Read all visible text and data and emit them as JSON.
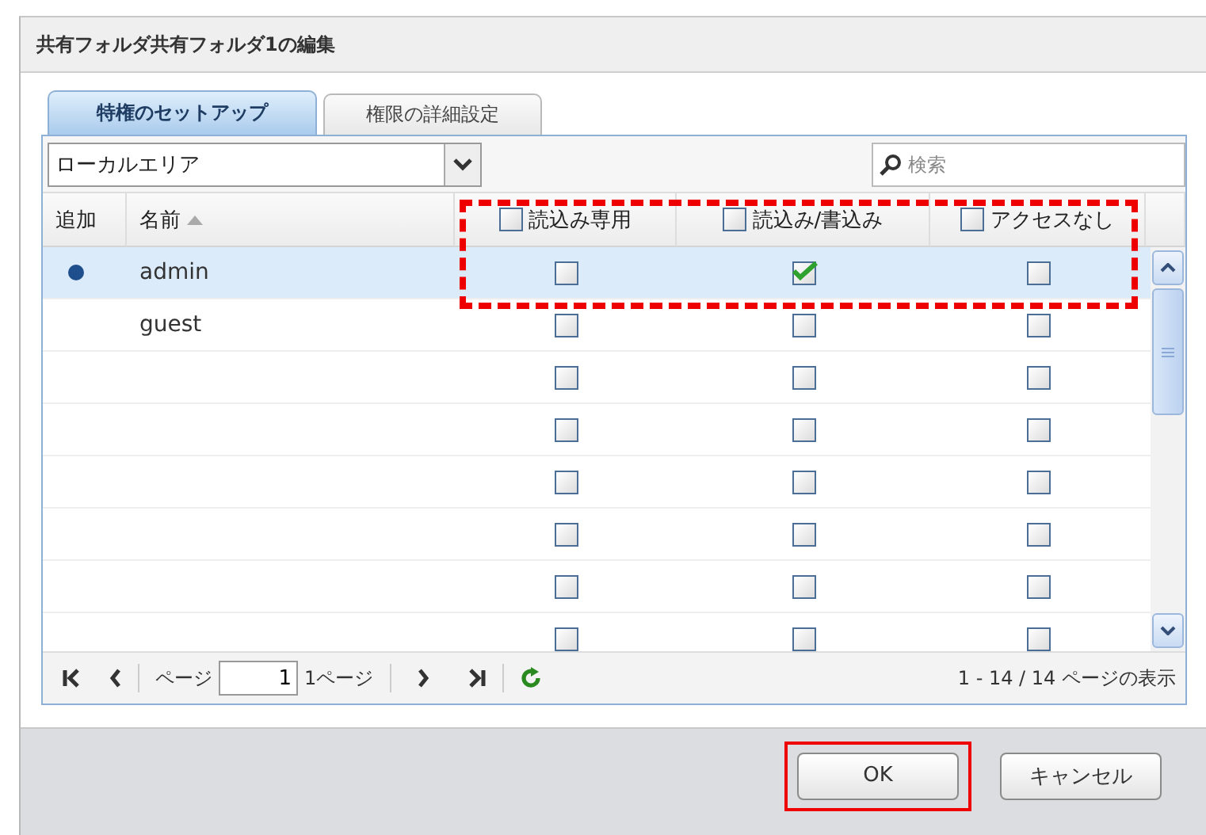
{
  "dialog": {
    "title": "共有フォルダ共有フォルダ1の編集"
  },
  "tabs": [
    {
      "label": "特権のセットアップ",
      "selected": true
    },
    {
      "label": "権限の詳細設定",
      "selected": false
    }
  ],
  "filter": {
    "value": "ローカルエリア"
  },
  "search": {
    "placeholder": "検索"
  },
  "columns": [
    {
      "label": "追加",
      "kind": "plain"
    },
    {
      "label": "名前",
      "kind": "sort"
    },
    {
      "label": "読込み専用",
      "kind": "check",
      "checked": false
    },
    {
      "label": "読込み/書込み",
      "kind": "check",
      "checked": false
    },
    {
      "label": "アクセスなし",
      "kind": "check",
      "checked": false
    }
  ],
  "rows": [
    {
      "name": "admin",
      "added": true,
      "selected": true,
      "perms": [
        false,
        true,
        false
      ]
    },
    {
      "name": "guest",
      "added": false,
      "selected": false,
      "perms": [
        false,
        false,
        false
      ]
    },
    {
      "added": false,
      "selected": false,
      "perms": [
        false,
        false,
        false
      ]
    },
    {
      "added": false,
      "selected": false,
      "perms": [
        false,
        false,
        false
      ]
    },
    {
      "added": false,
      "selected": false,
      "perms": [
        false,
        false,
        false
      ]
    },
    {
      "added": false,
      "selected": false,
      "perms": [
        false,
        false,
        false
      ]
    },
    {
      "added": false,
      "selected": false,
      "perms": [
        false,
        false,
        false
      ]
    },
    {
      "added": false,
      "selected": false,
      "perms": [
        false,
        false,
        false
      ]
    }
  ],
  "permission_highlight": true,
  "pager": {
    "page_label": "ページ",
    "page": "1",
    "total": "1ページ",
    "summary": "1 - 14 / 14 ページの表示"
  },
  "buttons": [
    {
      "label": "OK",
      "highlighted": true
    },
    {
      "label": "キャンセル",
      "highlighted": false
    }
  ]
}
